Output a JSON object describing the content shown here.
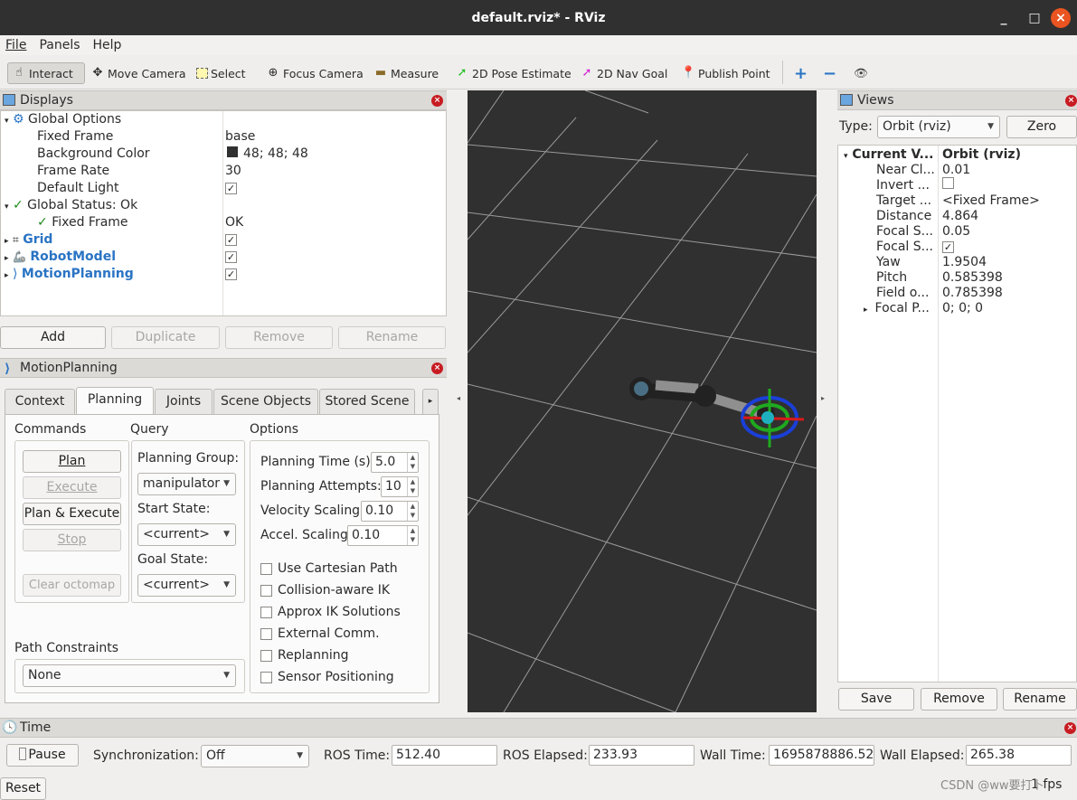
{
  "window": {
    "title": "default.rviz* - RViz",
    "minimize": "_",
    "maximize": "□",
    "close": "×"
  },
  "menubar": {
    "file": "File",
    "panels": "Panels",
    "help": "Help"
  },
  "toolbar": {
    "interact": "Interact",
    "move_camera": "Move Camera",
    "select": "Select",
    "focus_camera": "Focus Camera",
    "measure": "Measure",
    "pose_estimate": "2D Pose Estimate",
    "nav_goal": "2D Nav Goal",
    "publish_point": "Publish Point"
  },
  "displays": {
    "title": "Displays",
    "global_options": "Global Options",
    "fixed_frame_label": "Fixed Frame",
    "fixed_frame_value": "base",
    "bg_color_label": "Background Color",
    "bg_color_value": "48; 48; 48",
    "bg_color_swatch": "#303030",
    "frame_rate_label": "Frame Rate",
    "frame_rate_value": "30",
    "default_light_label": "Default Light",
    "global_status": "Global Status: Ok",
    "status_fixed_frame": "Fixed Frame",
    "status_fixed_frame_value": "OK",
    "grid": "Grid",
    "robot_model": "RobotModel",
    "motion_planning": "MotionPlanning",
    "add": "Add",
    "duplicate": "Duplicate",
    "remove": "Remove",
    "rename": "Rename"
  },
  "motion_planning": {
    "title": "MotionPlanning",
    "tabs": [
      "Context",
      "Planning",
      "Joints",
      "Scene Objects",
      "Stored Scene"
    ],
    "commands_label": "Commands",
    "query_label": "Query",
    "options_label": "Options",
    "plan": "Plan",
    "execute": "Execute",
    "plan_execute": "Plan & Execute",
    "stop": "Stop",
    "clear_octomap": "Clear octomap",
    "planning_group_label": "Planning Group:",
    "planning_group": "manipulator",
    "start_state_label": "Start State:",
    "start_state": "<current>",
    "goal_state_label": "Goal State:",
    "goal_state": "<current>",
    "planning_time_label": "Planning Time (s):",
    "planning_time": "5.0",
    "planning_attempts_label": "Planning Attempts:",
    "planning_attempts": "10",
    "velocity_scaling_label": "Velocity Scaling:",
    "velocity_scaling": "0.10",
    "accel_scaling_label": "Accel. Scaling:",
    "accel_scaling": "0.10",
    "checkboxes": [
      "Use Cartesian Path",
      "Collision-aware IK",
      "Approx IK Solutions",
      "External Comm.",
      "Replanning",
      "Sensor Positioning"
    ],
    "path_constraints_label": "Path Constraints",
    "path_constraints": "None"
  },
  "views": {
    "title": "Views",
    "type_label": "Type:",
    "type_value": "Orbit (rviz)",
    "zero": "Zero",
    "current_view": "Current V...",
    "current_view_value": "Orbit (rviz)",
    "props": [
      {
        "k": "Near Cl...",
        "v": "0.01"
      },
      {
        "k": "Invert ...",
        "v": ""
      },
      {
        "k": "Target ...",
        "v": "<Fixed Frame>"
      },
      {
        "k": "Distance",
        "v": "4.864"
      },
      {
        "k": "Focal S...",
        "v": "0.05"
      },
      {
        "k": "Focal S...",
        "v": ""
      },
      {
        "k": "Yaw",
        "v": "1.9504"
      },
      {
        "k": "Pitch",
        "v": "0.585398"
      },
      {
        "k": "Field o...",
        "v": "0.785398"
      },
      {
        "k": "Focal P...",
        "v": "0; 0; 0"
      }
    ],
    "save": "Save",
    "remove": "Remove",
    "rename": "Rename"
  },
  "time": {
    "title": "Time",
    "pause": "Pause",
    "sync_label": "Synchronization:",
    "sync_value": "Off",
    "ros_time_label": "ROS Time:",
    "ros_time": "512.40",
    "ros_elapsed_label": "ROS Elapsed:",
    "ros_elapsed": "233.93",
    "wall_time_label": "Wall Time:",
    "wall_time": "1695878886.52",
    "wall_elapsed_label": "Wall Elapsed:",
    "wall_elapsed": "265.38",
    "reset": "Reset",
    "fps": "1 fps",
    "watermark": "CSDN @ww要打卜"
  }
}
